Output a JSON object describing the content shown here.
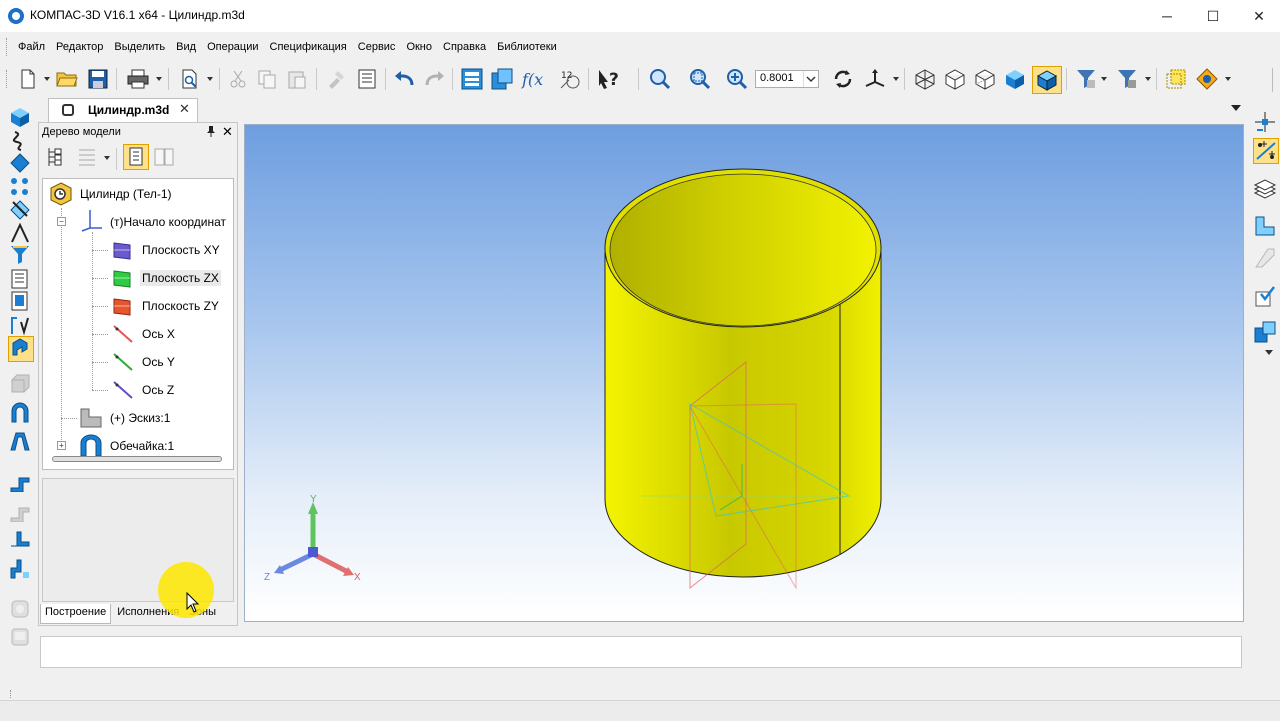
{
  "window": {
    "title": "КОМПАС-3D V16.1 x64 - Цилиндр.m3d",
    "minimize": "─",
    "maximize": "☐",
    "close": "✕"
  },
  "menu": [
    "Файл",
    "Редактор",
    "Выделить",
    "Вид",
    "Операции",
    "Спецификация",
    "Сервис",
    "Окно",
    "Справка",
    "Библиотеки"
  ],
  "toolbar": {
    "zoom_value": "0.8001",
    "icons": [
      "new-icon",
      "open-icon",
      "save-icon",
      "print-icon",
      "preview-icon",
      "cut-icon",
      "copy-icon",
      "paste-icon",
      "format-brush-icon",
      "properties-icon",
      "undo-icon",
      "redo-icon",
      "manager-icon",
      "library-icon",
      "variables-icon",
      "measure-icon",
      "help-icon",
      "zoom-window-icon",
      "zoom-fit-icon",
      "zoom-in-icon",
      "rotate-icon",
      "orientation-icon",
      "wireframe-icon",
      "hidden-lines-icon",
      "hidden-thin-icon",
      "halftone-icon",
      "halftone-edges-icon",
      "select-filter-icon",
      "filter-icon",
      "box-select-icon",
      "snap-icon"
    ]
  },
  "document_tab": {
    "label": "Цилиндр.m3d",
    "close": "✕"
  },
  "tree_panel": {
    "title": "Дерево модели",
    "pin": "ᴘ",
    "close": "✕",
    "items": [
      {
        "label": "Цилиндр (Тел-1)",
        "icon": "part-icon"
      },
      {
        "label": "(т)Начало координат",
        "icon": "origin-icon"
      },
      {
        "label": "Плоскость XY",
        "icon": "plane-xy-icon",
        "color": "#6a5acd"
      },
      {
        "label": "Плоскость ZX",
        "icon": "plane-zx-icon",
        "color": "#2ecc40"
      },
      {
        "label": "Плоскость ZY",
        "icon": "plane-zy-icon",
        "color": "#e8542b"
      },
      {
        "label": "Ось X",
        "icon": "axis-x-icon",
        "color": "#e05555"
      },
      {
        "label": "Ось Y",
        "icon": "axis-y-icon",
        "color": "#2faa2f"
      },
      {
        "label": "Ось Z",
        "icon": "axis-z-icon",
        "color": "#5b4fc9"
      },
      {
        "label": "(+) Эскиз:1",
        "icon": "sketch-icon"
      },
      {
        "label": "Обечайка:1",
        "icon": "shell-icon"
      }
    ],
    "tabs": [
      "Построение",
      "Исполнения",
      "Зоны"
    ]
  },
  "viewport": {
    "axis_labels": {
      "x": "X",
      "y": "Y",
      "z": "Z"
    },
    "model_color": "#f0f000",
    "background_top": "#6e9ee0",
    "background_bottom": "#ffffff"
  },
  "colors": {
    "accent_blue": "#1d6fc7",
    "highlight": "#ffe600"
  }
}
